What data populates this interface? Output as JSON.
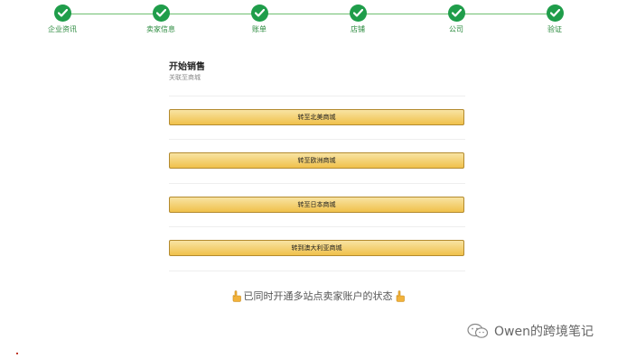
{
  "stepper": {
    "color": "#1f9d4a",
    "steps": [
      {
        "label": "企业资讯",
        "status": "complete"
      },
      {
        "label": "卖家信息",
        "status": "complete"
      },
      {
        "label": "账单",
        "status": "complete"
      },
      {
        "label": "店铺",
        "status": "complete"
      },
      {
        "label": "公司",
        "status": "complete"
      },
      {
        "label": "验证",
        "status": "complete"
      }
    ]
  },
  "panel": {
    "title": "开始销售",
    "subtitle": "关联至商城"
  },
  "marketplace_buttons": [
    {
      "label": "转至北美商城"
    },
    {
      "label": "转至欧洲商城"
    },
    {
      "label": "转至日本商城"
    },
    {
      "label": "转到澳大利亚商城"
    }
  ],
  "caption": {
    "text": "已同时开通多站点卖家账户的状态",
    "icon": "pointing-hand-icon"
  },
  "watermark": {
    "text": "Owen的跨境笔记",
    "icon": "wechat-icon"
  }
}
